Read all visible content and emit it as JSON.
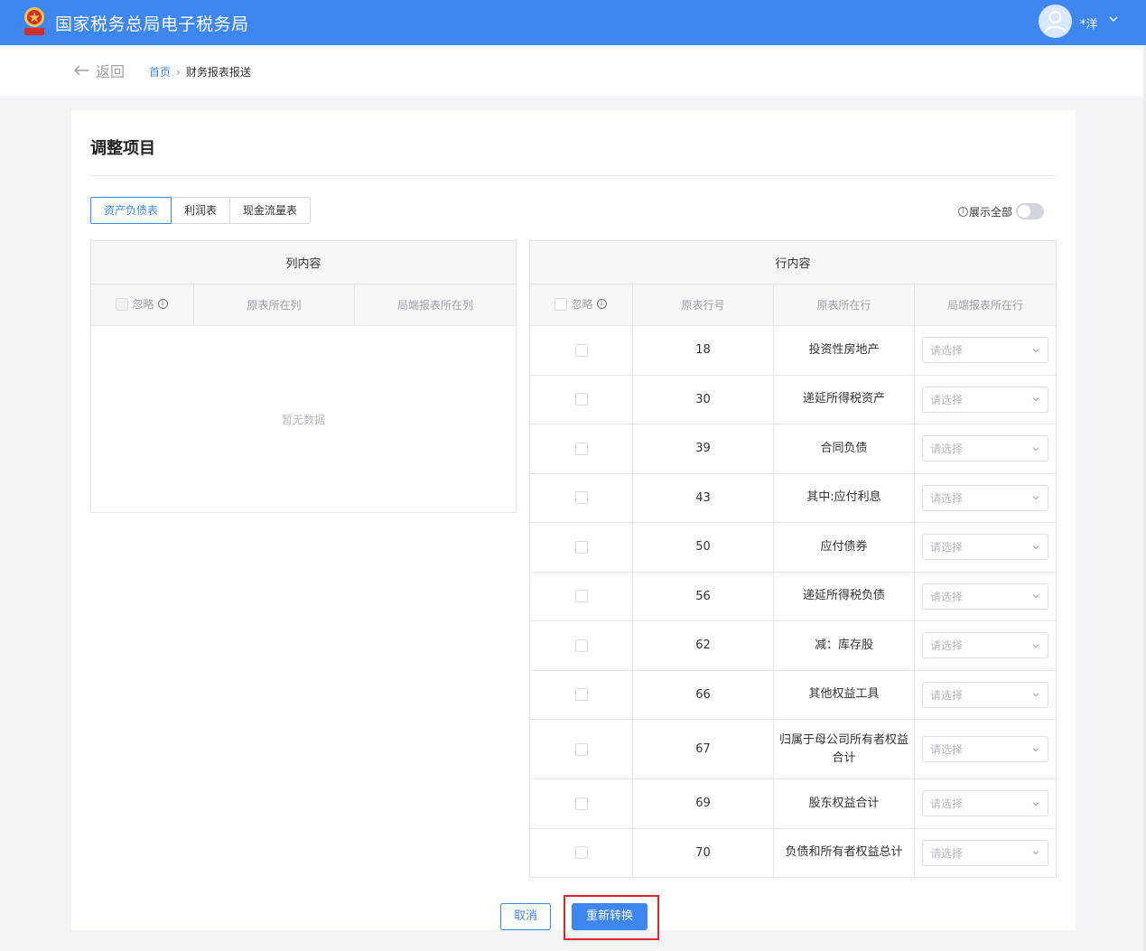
{
  "header": {
    "app_title": "国家税务总局电子税务局",
    "user_name": "*洋"
  },
  "nav": {
    "back_label": "返回",
    "breadcrumb_home": "首页",
    "breadcrumb_sep": "›",
    "breadcrumb_current": "财务报表报送"
  },
  "page": {
    "title": "调整项目",
    "tabs": [
      "资产负债表",
      "利润表",
      "现金流量表"
    ],
    "active_tab": "资产负债表",
    "show_all_label": "展示全部",
    "show_all_on": false
  },
  "column_table": {
    "title": "列内容",
    "headers": [
      "忽略",
      "原表所在列",
      "局端报表所在列"
    ],
    "empty_text": "暂无数据"
  },
  "row_table": {
    "title": "行内容",
    "headers": [
      "忽略",
      "原表行号",
      "原表所在行",
      "局端报表所在行"
    ],
    "select_placeholder": "请选择",
    "rows": [
      {
        "no": "18",
        "item": "投资性房地产"
      },
      {
        "no": "30",
        "item": "递延所得税资产"
      },
      {
        "no": "39",
        "item": "合同负债"
      },
      {
        "no": "43",
        "item": "其中:应付利息"
      },
      {
        "no": "50",
        "item": "应付债券"
      },
      {
        "no": "56",
        "item": "递延所得税负债"
      },
      {
        "no": "62",
        "item": "减：库存股"
      },
      {
        "no": "66",
        "item": "其他权益工具"
      },
      {
        "no": "67",
        "item": "归属于母公司所有者权益合计"
      },
      {
        "no": "69",
        "item": "股东权益合计"
      },
      {
        "no": "70",
        "item": "负债和所有者权益总计"
      }
    ]
  },
  "actions": {
    "cancel_label": "取消",
    "convert_label": "重新转换"
  },
  "colors": {
    "brand_blue": "#3e86f0",
    "highlight_red": "#e0262d"
  }
}
